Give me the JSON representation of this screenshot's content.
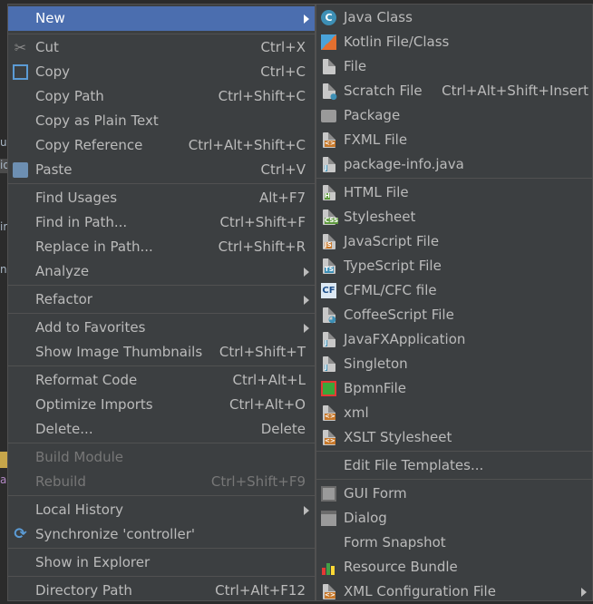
{
  "background": {
    "fragments": [
      "ul",
      "io",
      "ir",
      "n",
      "a"
    ]
  },
  "context_menu": {
    "items": [
      {
        "label": "New",
        "shortcut": "",
        "submenu": true
      },
      {
        "label": "Cut",
        "shortcut": "Ctrl+X",
        "icon": "scissors-icon"
      },
      {
        "label": "Copy",
        "shortcut": "Ctrl+C",
        "icon": "copy-icon"
      },
      {
        "label": "Copy Path",
        "shortcut": "Ctrl+Shift+C"
      },
      {
        "label": "Copy as Plain Text",
        "shortcut": ""
      },
      {
        "label": "Copy Reference",
        "shortcut": "Ctrl+Alt+Shift+C"
      },
      {
        "label": "Paste",
        "shortcut": "Ctrl+V",
        "icon": "paste-icon"
      },
      {
        "label": "Find Usages",
        "shortcut": "Alt+F7"
      },
      {
        "label": "Find in Path...",
        "shortcut": "Ctrl+Shift+F"
      },
      {
        "label": "Replace in Path...",
        "shortcut": "Ctrl+Shift+R"
      },
      {
        "label": "Analyze",
        "shortcut": "",
        "submenu": true
      },
      {
        "label": "Refactor",
        "shortcut": "",
        "submenu": true
      },
      {
        "label": "Add to Favorites",
        "shortcut": "",
        "submenu": true
      },
      {
        "label": "Show Image Thumbnails",
        "shortcut": "Ctrl+Shift+T"
      },
      {
        "label": "Reformat Code",
        "shortcut": "Ctrl+Alt+L"
      },
      {
        "label": "Optimize Imports",
        "shortcut": "Ctrl+Alt+O"
      },
      {
        "label": "Delete...",
        "shortcut": "Delete"
      },
      {
        "label": "Build Module",
        "shortcut": "",
        "disabled": true
      },
      {
        "label": "Rebuild",
        "shortcut": "Ctrl+Shift+F9",
        "disabled": true
      },
      {
        "label": "Local History",
        "shortcut": "",
        "submenu": true
      },
      {
        "label": "Synchronize 'controller'",
        "shortcut": "",
        "icon": "sync-icon"
      },
      {
        "label": "Show in Explorer",
        "shortcut": ""
      },
      {
        "label": "Directory Path",
        "shortcut": "Ctrl+Alt+F12"
      }
    ]
  },
  "new_submenu": {
    "items": [
      {
        "label": "Java Class",
        "shortcut": "",
        "icon": "java-class-icon"
      },
      {
        "label": "Kotlin File/Class",
        "shortcut": "",
        "icon": "kotlin-icon"
      },
      {
        "label": "File",
        "shortcut": "",
        "icon": "file-icon"
      },
      {
        "label": "Scratch File",
        "shortcut": "Ctrl+Alt+Shift+Insert",
        "icon": "scratch-file-icon"
      },
      {
        "label": "Package",
        "shortcut": "",
        "icon": "package-icon"
      },
      {
        "label": "FXML File",
        "shortcut": "",
        "icon": "fxml-icon",
        "tag": "<>"
      },
      {
        "label": "package-info.java",
        "shortcut": "",
        "icon": "package-info-icon",
        "tag": "J"
      },
      {
        "label": "HTML File",
        "shortcut": "",
        "icon": "html-icon",
        "tag": "H"
      },
      {
        "label": "Stylesheet",
        "shortcut": "",
        "icon": "css-icon",
        "tag": "CSS"
      },
      {
        "label": "JavaScript File",
        "shortcut": "",
        "icon": "javascript-icon",
        "tag": "JS"
      },
      {
        "label": "TypeScript File",
        "shortcut": "",
        "icon": "typescript-icon",
        "tag": "TS"
      },
      {
        "label": "CFML/CFC file",
        "shortcut": "",
        "icon": "cfml-icon",
        "tag": "CF"
      },
      {
        "label": "CoffeeScript File",
        "shortcut": "",
        "icon": "coffeescript-icon"
      },
      {
        "label": "JavaFXApplication",
        "shortcut": "",
        "icon": "javafx-icon",
        "tag": "J"
      },
      {
        "label": "Singleton",
        "shortcut": "",
        "icon": "singleton-icon",
        "tag": "J"
      },
      {
        "label": "BpmnFile",
        "shortcut": "",
        "icon": "bpmn-icon"
      },
      {
        "label": "xml",
        "shortcut": "",
        "icon": "xml-icon",
        "tag": "<>"
      },
      {
        "label": "XSLT Stylesheet",
        "shortcut": "",
        "icon": "xslt-icon",
        "tag": "<>"
      },
      {
        "label": "Edit File Templates...",
        "shortcut": ""
      },
      {
        "label": "GUI Form",
        "shortcut": "",
        "icon": "gui-form-icon"
      },
      {
        "label": "Dialog",
        "shortcut": "",
        "icon": "dialog-icon"
      },
      {
        "label": "Form Snapshot",
        "shortcut": ""
      },
      {
        "label": "Resource Bundle",
        "shortcut": "",
        "icon": "resource-bundle-icon"
      },
      {
        "label": "XML Configuration File",
        "shortcut": "",
        "icon": "xml-config-icon",
        "tag": "<>",
        "submenu": true
      }
    ]
  },
  "colors": {
    "menu_bg": "#3c3f41",
    "selection": "#4b6eaf",
    "text": "#bbbbbb",
    "disabled": "#777777"
  }
}
